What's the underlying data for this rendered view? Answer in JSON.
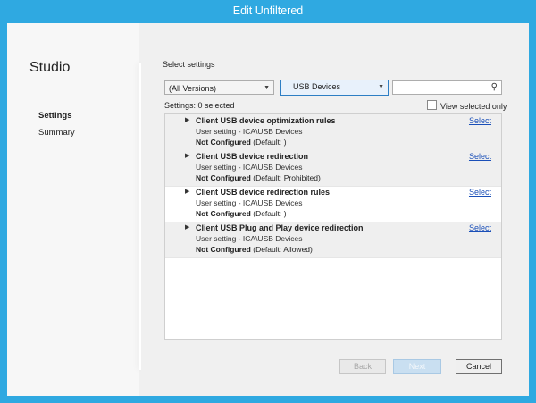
{
  "window": {
    "title": "Edit Unfiltered"
  },
  "sidebar": {
    "app_name": "Studio",
    "items": [
      {
        "label": "Settings",
        "active": true
      },
      {
        "label": "Summary",
        "active": false
      }
    ]
  },
  "main": {
    "heading": "Select settings",
    "version_dropdown": "(All Versions)",
    "category_dropdown": "USB Devices",
    "search": {
      "value": "",
      "placeholder": ""
    },
    "settings_count": "Settings: 0 selected",
    "view_selected_label": "View selected only",
    "view_selected_checked": false,
    "settings": [
      {
        "name": "Client USB device optimization rules",
        "category": "User setting - ICA\\USB Devices",
        "status": "Not Configured",
        "default": "(Default: )",
        "action": "Select"
      },
      {
        "name": "Client USB device redirection",
        "category": "User setting - ICA\\USB Devices",
        "status": "Not Configured",
        "default": "(Default: Prohibited)",
        "action": "Select"
      },
      {
        "name": "Client USB device redirection rules",
        "category": "User setting - ICA\\USB Devices",
        "status": "Not Configured",
        "default": "(Default: )",
        "action": "Select"
      },
      {
        "name": "Client USB Plug and Play device redirection",
        "category": "User setting - ICA\\USB Devices",
        "status": "Not Configured",
        "default": "(Default: Allowed)",
        "action": "Select"
      }
    ]
  },
  "buttons": {
    "back": "Back",
    "next": "Next",
    "cancel": "Cancel"
  },
  "colors": {
    "title_bar": "#2fa9e1",
    "link": "#1a4fb8",
    "dropdown_highlight": "#2d7ec4"
  },
  "icons": {
    "expand": "triangle-right",
    "search": "magnifier",
    "dropdown": "chevron-down"
  }
}
